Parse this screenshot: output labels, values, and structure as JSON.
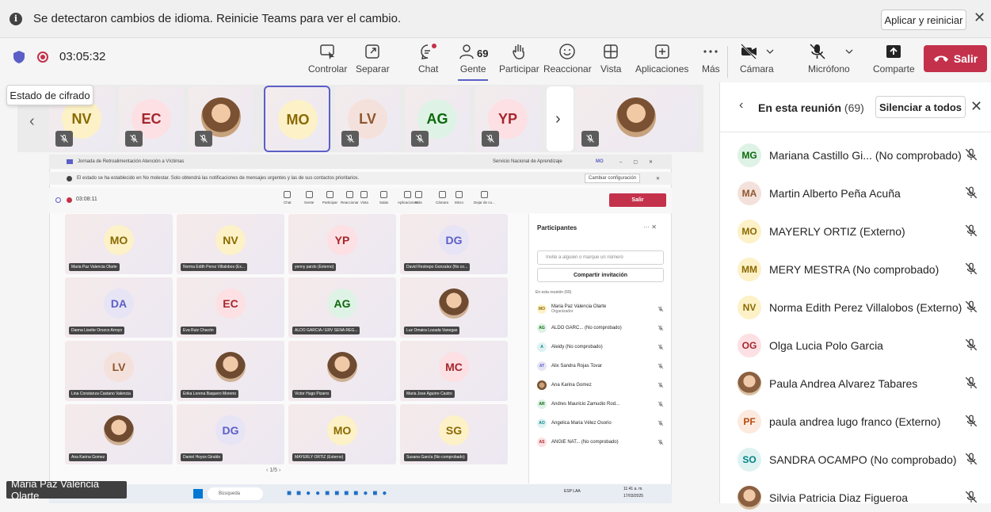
{
  "banner": {
    "message": "Se detectaron cambios de idioma. Reinicie Teams para ver el cambio.",
    "apply_label": "Aplicar y reiniciar",
    "close": "✕"
  },
  "meeting": {
    "timer": "03:05:32"
  },
  "toolbar": {
    "controlar": "Controlar",
    "separar": "Separar",
    "chat": "Chat",
    "gente": "Gente",
    "gente_count": "69",
    "participar": "Participar",
    "reaccionar": "Reaccionar",
    "vista": "Vista",
    "aplicaciones": "Aplicaciones",
    "mas": "Más",
    "camara": "Cámara",
    "microfono": "Micrófono",
    "comparte": "Comparte",
    "salir": "Salir"
  },
  "tooltip": "Estado de cifrado",
  "strip": {
    "tiles": [
      {
        "initials": "NV",
        "bg": "#fdf1c8",
        "fg": "#8a6a00"
      },
      {
        "initials": "EC",
        "bg": "#fde0e3",
        "fg": "#a4262c"
      },
      {
        "initials": "",
        "photo": true
      },
      {
        "initials": "MO",
        "bg": "#fdf1c8",
        "fg": "#8a6a00",
        "active": true
      },
      {
        "initials": "LV",
        "bg": "#f4e1db",
        "fg": "#8e562e"
      },
      {
        "initials": "AG",
        "bg": "#dff2e6",
        "fg": "#0b6a0b"
      },
      {
        "initials": "YP",
        "bg": "#fde0e3",
        "fg": "#a4262c"
      },
      {
        "initials": "",
        "photo": true
      }
    ],
    "next": "›",
    "prev": "‹"
  },
  "shared": {
    "title": "Jornada de Retroalimentación Atención a Víctimas",
    "org": "Servicio Nacional de Aprendizaje",
    "org_code": "MO",
    "status": "El estado se ha establecido en No molestar. Solo obtendrá las notificaciones de mensajes urgentes y las de sus contactos prioritarios.",
    "status_btn": "Cambiar configuración",
    "timer": "03:08:11",
    "gente_count": "69",
    "tb": [
      "Chat",
      "Gente",
      "Participar",
      "Reaccionar",
      "Vista",
      "Salas",
      "Aplicaciones",
      "Más",
      "Cámara",
      "Micro",
      "Dejar de co...",
      "Salir"
    ],
    "tiles": [
      {
        "initials": "MO",
        "name": "Maria Paz Valencia Olarte",
        "bg": "#fdf1c8",
        "fg": "#8a6a00"
      },
      {
        "initials": "NV",
        "name": "Norma Edith Perez Villalobos (Ex...",
        "bg": "#fdf1c8",
        "fg": "#8a6a00"
      },
      {
        "initials": "YP",
        "name": "yenny pardo (Externo)",
        "bg": "#fde0e3",
        "fg": "#a4262c"
      },
      {
        "initials": "DG",
        "name": "David Restrepo Gonzalez (No co...",
        "bg": "#e7e4f5",
        "fg": "#5b5fc7"
      },
      {
        "initials": "DA",
        "name": "Danna Lisette Orozco Arroyo",
        "bg": "#e7e4f5",
        "fg": "#5b5fc7"
      },
      {
        "initials": "EC",
        "name": "Eva Ruiz Chacón",
        "bg": "#fde0e3",
        "fg": "#a4262c"
      },
      {
        "initials": "AG",
        "name": "ALDO GARCIA / ERV SENA REG...",
        "bg": "#dff2e6",
        "fg": "#0b6a0b"
      },
      {
        "initials": "",
        "name": "Luz Omaira Lozada Vanegas",
        "photo": true
      },
      {
        "initials": "LV",
        "name": "Lina Constanza Castano Valencia",
        "bg": "#f4e1db",
        "fg": "#8e562e"
      },
      {
        "initials": "",
        "name": "Erika Lorena Baquero Moreno",
        "photo": true
      },
      {
        "initials": "",
        "name": "Victor Hugo Pizarro",
        "photo": true
      },
      {
        "initials": "MC",
        "name": "Maria Jose Aguirre Castro",
        "bg": "#fde0e3",
        "fg": "#a4262c"
      },
      {
        "initials": "",
        "name": "Ana Karina Gomez",
        "photo": true
      },
      {
        "initials": "DG",
        "name": "Daniel Hoyos Giraldo",
        "bg": "#e7e4f5",
        "fg": "#5b5fc7"
      },
      {
        "initials": "MO",
        "name": "MAYERLY ORTIZ (Externo)",
        "bg": "#fdf1c8",
        "fg": "#8a6a00"
      },
      {
        "initials": "SG",
        "name": "Susana García (No comprobado)",
        "bg": "#fdf1c8",
        "fg": "#8a6a00"
      }
    ],
    "pager": "1/5",
    "pane": {
      "title": "Participantes",
      "invite": "Invite a alguien o marque un número",
      "share": "Compartir invitación",
      "section": "En esta reunión (69)",
      "rows": [
        {
          "initials": "MO",
          "name": "Maria Paz Valencia Olarte",
          "sub": "Organizador",
          "bg": "#fdf1c8",
          "fg": "#8a6a00"
        },
        {
          "initials": "AG",
          "name": "ALDO GARC... (No comprobado)",
          "bg": "#dff2e6",
          "fg": "#0b6a0b"
        },
        {
          "initials": "A",
          "name": "Aleidy (No comprobado)",
          "bg": "#dff2f2",
          "fg": "#038387"
        },
        {
          "initials": "AT",
          "name": "Alix Sandra Rojas Tovar",
          "bg": "#e7e4f5",
          "fg": "#5b5fc7"
        },
        {
          "initials": "",
          "name": "Ana Karina Gomez",
          "photo": true
        },
        {
          "initials": "AR",
          "name": "Andres Mauricio Zamudio Rod...",
          "bg": "#dff2e6",
          "fg": "#0b6a0b"
        },
        {
          "initials": "AO",
          "name": "Angelica Maria Vélez Osorio",
          "bg": "#dff2f2",
          "fg": "#038387"
        },
        {
          "initials": "AS",
          "name": "ANGIE NAT... (No comprobado)",
          "bg": "#fde0e3",
          "fg": "#a4262c"
        }
      ]
    },
    "taskbar": {
      "search": "Búsqueda",
      "lang": "ESP LAA",
      "time": "11:41 a. m.",
      "date": "17/03/2025"
    }
  },
  "video_label": "Maria Paz Valencia Olarte",
  "panel": {
    "title": "En esta reunión",
    "count": "(69)",
    "mute_all": "Silenciar a todos",
    "participants": [
      {
        "initials": "MG",
        "name": "Mariana Castillo Gi... (No comprobado)",
        "bg": "#dff2e6",
        "fg": "#0b6a0b"
      },
      {
        "initials": "MA",
        "name": "Martin Alberto Peña Acuña",
        "bg": "#f4e1db",
        "fg": "#8e562e"
      },
      {
        "initials": "MO",
        "name": "MAYERLY ORTIZ (Externo)",
        "bg": "#fdf1c8",
        "fg": "#8a6a00"
      },
      {
        "initials": "MM",
        "name": "MERY MESTRA (No comprobado)",
        "bg": "#fdf1c8",
        "fg": "#8a6a00"
      },
      {
        "initials": "NV",
        "name": "Norma Edith Perez Villalobos (Externo)",
        "bg": "#fdf1c8",
        "fg": "#8a6a00"
      },
      {
        "initials": "OG",
        "name": "Olga Lucia Polo Garcia",
        "bg": "#fde0e3",
        "fg": "#a4262c"
      },
      {
        "initials": "",
        "name": "Paula Andrea Alvarez Tabares",
        "photo": true
      },
      {
        "initials": "PF",
        "name": "paula andrea lugo franco (Externo)",
        "bg": "#fdeadf",
        "fg": "#b84a10"
      },
      {
        "initials": "SO",
        "name": "SANDRA OCAMPO (No comprobado)",
        "bg": "#dff2f2",
        "fg": "#038387"
      },
      {
        "initials": "",
        "name": "Silvia Patricia Diaz Figueroa",
        "photo": true
      }
    ]
  }
}
